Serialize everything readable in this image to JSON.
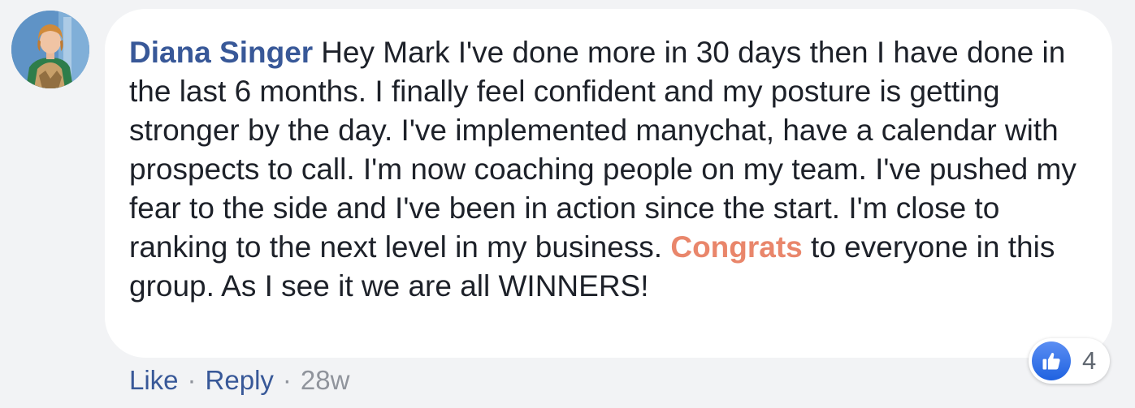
{
  "comment": {
    "author": "Diana Singer",
    "text_before": "Hey Mark I've done more in 30 days then I have done in the last 6 months. I finally feel confident and my posture is getting stronger by the day. I've implemented manychat, have a calendar with prospects to call. I'm now coaching people on my team. I've pushed my fear to the side and I've been in action since the start. I'm close to ranking to the next level in my business.",
    "highlight": "Congrats",
    "text_after": "to everyone in this group. As I see it we are all WINNERS!",
    "reaction_icon": "like-icon",
    "reaction_count": "4"
  },
  "actions": {
    "like_label": "Like",
    "separator": "·",
    "reply_label": "Reply",
    "timestamp": "28w"
  },
  "colors": {
    "author": "#385898",
    "highlight": "#e9866b",
    "background": "#f2f3f5",
    "bubble": "#ffffff"
  }
}
